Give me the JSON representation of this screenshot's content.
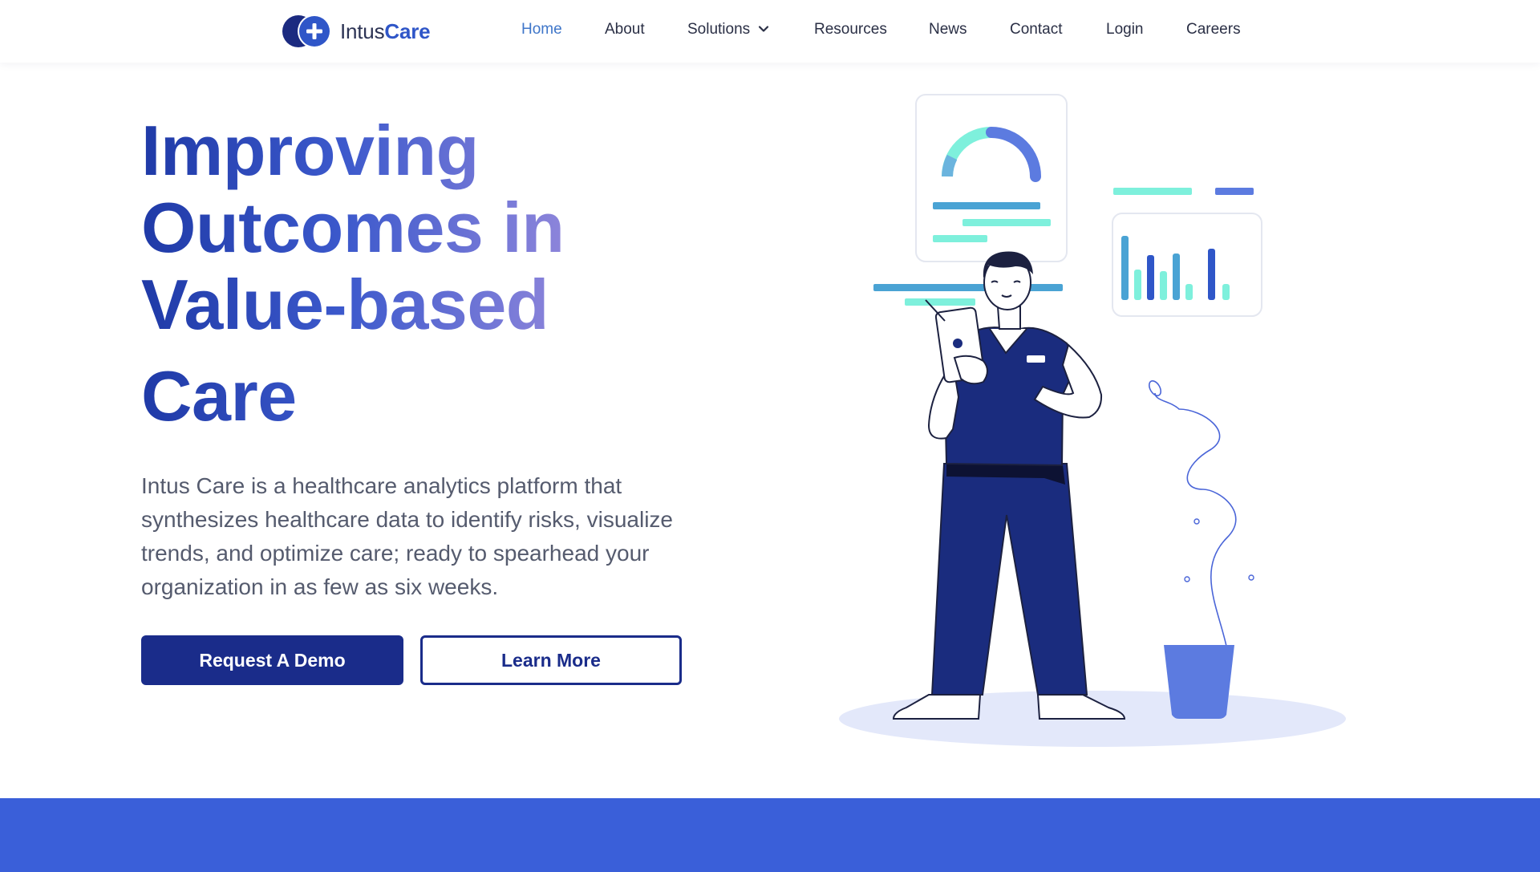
{
  "header": {
    "logo": {
      "text_regular": "Intus",
      "text_bold": "Care"
    },
    "nav": {
      "home": "Home",
      "about": "About",
      "solutions": "Solutions",
      "resources": "Resources",
      "news": "News",
      "contact": "Contact",
      "login": "Login",
      "careers": "Careers"
    },
    "active_item": "Home"
  },
  "hero": {
    "title_lines": [
      "Improving",
      "Outcomes in",
      "Value-based",
      "Care"
    ],
    "description": "Intus Care is a healthcare analytics platform that synthesizes healthcare data to identify risks, visualize trends, and optimize care; ready to spearhead your organization in as few as six weeks.",
    "primary_button": "Request A Demo",
    "secondary_button": "Learn More"
  },
  "colors": {
    "brand_navy": "#1a2c8a",
    "brand_blue": "#2f56c8",
    "nav_active": "#3f76c9",
    "accent_teal": "#7ef0dc",
    "band_blue": "#3a5fd9"
  },
  "icons": [
    "logo-mark-icon",
    "chevron-down-icon"
  ]
}
